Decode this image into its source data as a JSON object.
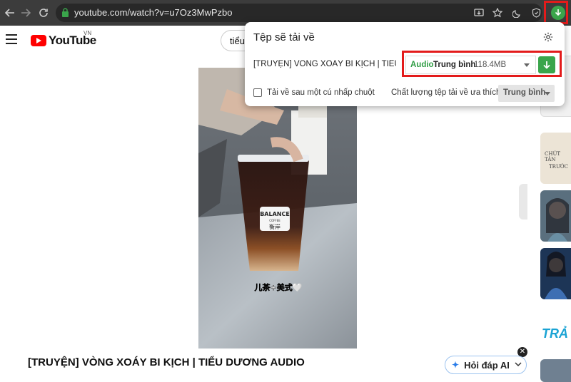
{
  "browser": {
    "url": "youtube.com/watch?v=u7Oz3MwPzbo",
    "back_icon": "arrow-left-icon",
    "forward_icon": "arrow-right-icon",
    "reload_icon": "reload-icon"
  },
  "youtube": {
    "logo_text": "YouTube",
    "region": "VN",
    "search_text": "tiểu",
    "video_title": "[TRUYỆN] VÒNG XOÁY BI KỊCH | TIỂU DƯƠNG AUDIO",
    "video_overlay": {
      "cup_brand": "BALANCE",
      "cup_sub": "COFFEE",
      "cup_chars": "衡岸",
      "caption": "儿茶+美式🤍"
    },
    "rail_captions": [
      "CHÚT TÀN",
      "TRƯỚC",
      "TRẢ"
    ],
    "ask_ai_label": "Hỏi đáp AI",
    "close_symbol": "✕"
  },
  "download_popup": {
    "title": "Tệp sẽ tải về",
    "file_name": "[TRUYỆN] VÒNG XOÁY BI KỊCH | TIỂU D...",
    "format": "Audio",
    "quality": "Trung bình",
    "size": "118.4MB",
    "checkbox_label": "Tải về sau một cú nhấp chuột",
    "pref_label": "Chất lượng tệp tải về ưa thích",
    "pref_value": "Trung bình"
  },
  "colors": {
    "accent_green": "#3aa54b",
    "highlight_red": "#e31b1b",
    "youtube_red": "#ff0000"
  }
}
